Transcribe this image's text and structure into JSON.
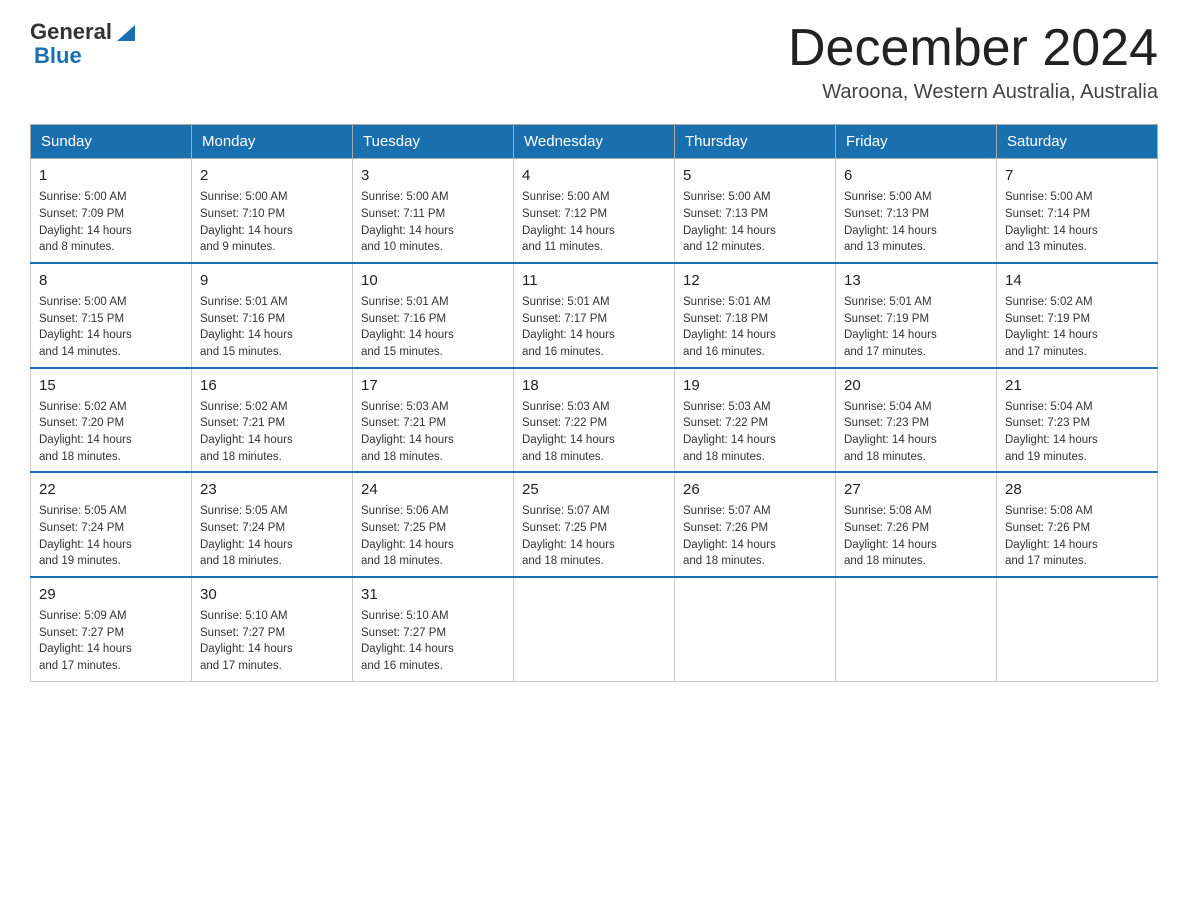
{
  "header": {
    "logo_general": "General",
    "logo_blue": "Blue",
    "month_title": "December 2024",
    "location": "Waroona, Western Australia, Australia"
  },
  "weekdays": [
    "Sunday",
    "Monday",
    "Tuesday",
    "Wednesday",
    "Thursday",
    "Friday",
    "Saturday"
  ],
  "weeks": [
    [
      {
        "day": "1",
        "sunrise": "5:00 AM",
        "sunset": "7:09 PM",
        "daylight": "14 hours and 8 minutes."
      },
      {
        "day": "2",
        "sunrise": "5:00 AM",
        "sunset": "7:10 PM",
        "daylight": "14 hours and 9 minutes."
      },
      {
        "day": "3",
        "sunrise": "5:00 AM",
        "sunset": "7:11 PM",
        "daylight": "14 hours and 10 minutes."
      },
      {
        "day": "4",
        "sunrise": "5:00 AM",
        "sunset": "7:12 PM",
        "daylight": "14 hours and 11 minutes."
      },
      {
        "day": "5",
        "sunrise": "5:00 AM",
        "sunset": "7:13 PM",
        "daylight": "14 hours and 12 minutes."
      },
      {
        "day": "6",
        "sunrise": "5:00 AM",
        "sunset": "7:13 PM",
        "daylight": "14 hours and 13 minutes."
      },
      {
        "day": "7",
        "sunrise": "5:00 AM",
        "sunset": "7:14 PM",
        "daylight": "14 hours and 13 minutes."
      }
    ],
    [
      {
        "day": "8",
        "sunrise": "5:00 AM",
        "sunset": "7:15 PM",
        "daylight": "14 hours and 14 minutes."
      },
      {
        "day": "9",
        "sunrise": "5:01 AM",
        "sunset": "7:16 PM",
        "daylight": "14 hours and 15 minutes."
      },
      {
        "day": "10",
        "sunrise": "5:01 AM",
        "sunset": "7:16 PM",
        "daylight": "14 hours and 15 minutes."
      },
      {
        "day": "11",
        "sunrise": "5:01 AM",
        "sunset": "7:17 PM",
        "daylight": "14 hours and 16 minutes."
      },
      {
        "day": "12",
        "sunrise": "5:01 AM",
        "sunset": "7:18 PM",
        "daylight": "14 hours and 16 minutes."
      },
      {
        "day": "13",
        "sunrise": "5:01 AM",
        "sunset": "7:19 PM",
        "daylight": "14 hours and 17 minutes."
      },
      {
        "day": "14",
        "sunrise": "5:02 AM",
        "sunset": "7:19 PM",
        "daylight": "14 hours and 17 minutes."
      }
    ],
    [
      {
        "day": "15",
        "sunrise": "5:02 AM",
        "sunset": "7:20 PM",
        "daylight": "14 hours and 18 minutes."
      },
      {
        "day": "16",
        "sunrise": "5:02 AM",
        "sunset": "7:21 PM",
        "daylight": "14 hours and 18 minutes."
      },
      {
        "day": "17",
        "sunrise": "5:03 AM",
        "sunset": "7:21 PM",
        "daylight": "14 hours and 18 minutes."
      },
      {
        "day": "18",
        "sunrise": "5:03 AM",
        "sunset": "7:22 PM",
        "daylight": "14 hours and 18 minutes."
      },
      {
        "day": "19",
        "sunrise": "5:03 AM",
        "sunset": "7:22 PM",
        "daylight": "14 hours and 18 minutes."
      },
      {
        "day": "20",
        "sunrise": "5:04 AM",
        "sunset": "7:23 PM",
        "daylight": "14 hours and 18 minutes."
      },
      {
        "day": "21",
        "sunrise": "5:04 AM",
        "sunset": "7:23 PM",
        "daylight": "14 hours and 19 minutes."
      }
    ],
    [
      {
        "day": "22",
        "sunrise": "5:05 AM",
        "sunset": "7:24 PM",
        "daylight": "14 hours and 19 minutes."
      },
      {
        "day": "23",
        "sunrise": "5:05 AM",
        "sunset": "7:24 PM",
        "daylight": "14 hours and 18 minutes."
      },
      {
        "day": "24",
        "sunrise": "5:06 AM",
        "sunset": "7:25 PM",
        "daylight": "14 hours and 18 minutes."
      },
      {
        "day": "25",
        "sunrise": "5:07 AM",
        "sunset": "7:25 PM",
        "daylight": "14 hours and 18 minutes."
      },
      {
        "day": "26",
        "sunrise": "5:07 AM",
        "sunset": "7:26 PM",
        "daylight": "14 hours and 18 minutes."
      },
      {
        "day": "27",
        "sunrise": "5:08 AM",
        "sunset": "7:26 PM",
        "daylight": "14 hours and 18 minutes."
      },
      {
        "day": "28",
        "sunrise": "5:08 AM",
        "sunset": "7:26 PM",
        "daylight": "14 hours and 17 minutes."
      }
    ],
    [
      {
        "day": "29",
        "sunrise": "5:09 AM",
        "sunset": "7:27 PM",
        "daylight": "14 hours and 17 minutes."
      },
      {
        "day": "30",
        "sunrise": "5:10 AM",
        "sunset": "7:27 PM",
        "daylight": "14 hours and 17 minutes."
      },
      {
        "day": "31",
        "sunrise": "5:10 AM",
        "sunset": "7:27 PM",
        "daylight": "14 hours and 16 minutes."
      },
      null,
      null,
      null,
      null
    ]
  ]
}
